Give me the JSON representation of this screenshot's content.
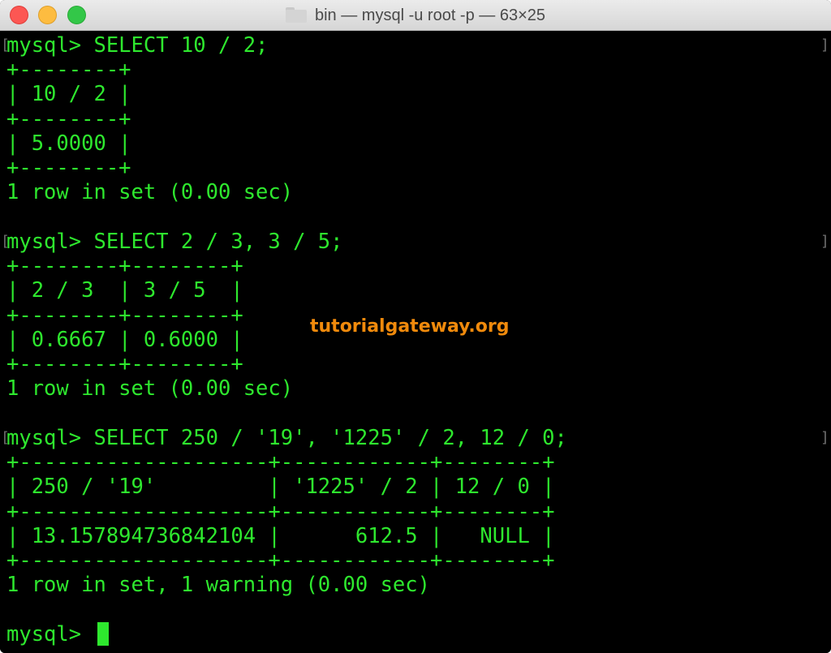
{
  "window": {
    "title": "bin — mysql -u root -p — 63×25"
  },
  "terminal": {
    "lines": [
      "mysql> SELECT 10 / 2;",
      "+--------+",
      "| 10 / 2 |",
      "+--------+",
      "| 5.0000 |",
      "+--------+",
      "1 row in set (0.00 sec)",
      "",
      "mysql> SELECT 2 / 3, 3 / 5;",
      "+--------+--------+",
      "| 2 / 3  | 3 / 5  |",
      "+--------+--------+",
      "| 0.6667 | 0.6000 |",
      "+--------+--------+",
      "1 row in set (0.00 sec)",
      "",
      "mysql> SELECT 250 / '19', '1225' / 2, 12 / 0;",
      "+--------------------+------------+--------+",
      "| 250 / '19'         | '1225' / 2 | 12 / 0 |",
      "+--------------------+------------+--------+",
      "| 13.157894736842104 |      612.5 |   NULL |",
      "+--------------------+------------+--------+",
      "1 row in set, 1 warning (0.00 sec)",
      "",
      "mysql> "
    ],
    "bracket_left": "[",
    "bracket_right": "]",
    "text_color": "#2ee82e",
    "background_color": "#000000"
  },
  "watermark": {
    "text": "tutorialgateway.org",
    "color": "#f08a0c"
  },
  "colors": {
    "close": "#fc5753",
    "minimize": "#fdbc40",
    "zoom": "#33c748"
  }
}
